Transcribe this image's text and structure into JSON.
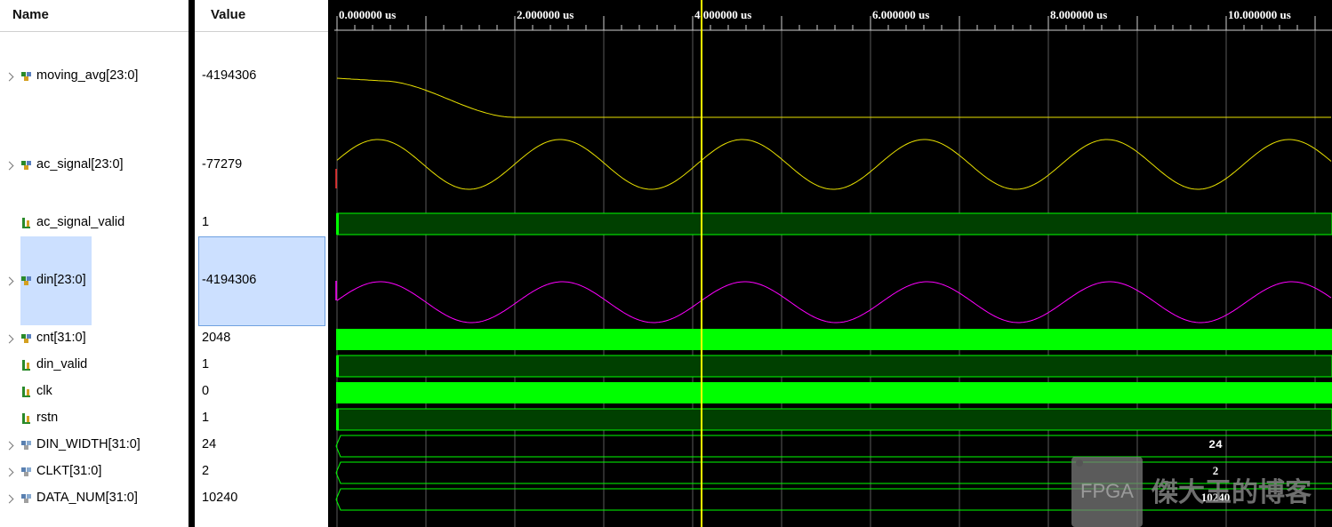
{
  "headers": {
    "name": "Name",
    "value": "Value"
  },
  "signals": [
    {
      "name": "moving_avg[23:0]",
      "value": "-4194306",
      "type": "bus",
      "expandable": true
    },
    {
      "name": "ac_signal[23:0]",
      "value": "-77279",
      "type": "bus",
      "expandable": true
    },
    {
      "name": "ac_signal_valid",
      "value": "1",
      "type": "bit",
      "expandable": false
    },
    {
      "name": "din[23:0]",
      "value": "-4194306",
      "type": "bus",
      "expandable": true,
      "selected": true
    },
    {
      "name": "cnt[31:0]",
      "value": "2048",
      "type": "bus",
      "expandable": true
    },
    {
      "name": "din_valid",
      "value": "1",
      "type": "bit",
      "expandable": false
    },
    {
      "name": "clk",
      "value": "0",
      "type": "bit",
      "expandable": false
    },
    {
      "name": "rstn",
      "value": "1",
      "type": "bit",
      "expandable": false
    },
    {
      "name": "DIN_WIDTH[31:0]",
      "value": "24",
      "type": "param",
      "expandable": true
    },
    {
      "name": "CLKT[31:0]",
      "value": "2",
      "type": "param",
      "expandable": true
    },
    {
      "name": "DATA_NUM[31:0]",
      "value": "10240",
      "type": "param",
      "expandable": true
    }
  ],
  "timeline": {
    "unit": "us",
    "labels": [
      "0.000000 us",
      "2.000000 us",
      "4.000000 us",
      "6.000000 us",
      "8.000000 us",
      "10.000000 us"
    ]
  },
  "cursor_time_us": 4.1,
  "bus_labels": {
    "din_width": "24",
    "clkt": "2",
    "data_num": "10240"
  },
  "watermark": {
    "badge": "FPGA",
    "text": "傑大王的博客"
  },
  "colors": {
    "analog_yellow": "#e8e000",
    "analog_magenta": "#ff00ff",
    "digital_green": "#00ff00",
    "dark_green": "#004000",
    "cursor": "#ffff00",
    "grid": "#5a5a5a",
    "selection": "#cce0ff"
  }
}
